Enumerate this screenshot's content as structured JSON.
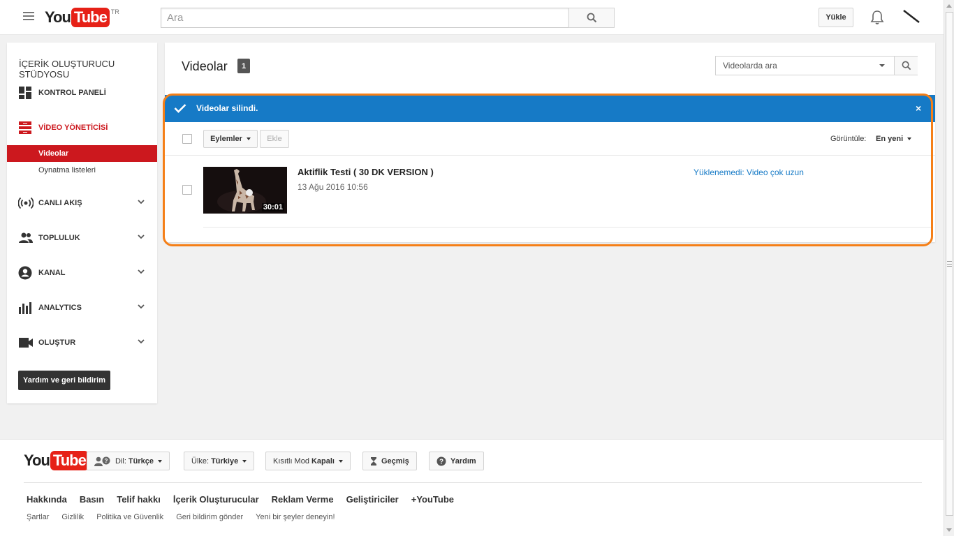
{
  "header": {
    "logo_you": "You",
    "logo_tube": "Tube",
    "region": "TR",
    "search_placeholder": "Ara",
    "upload_label": "Yükle"
  },
  "sidebar": {
    "title": "İÇERİK OLUŞTURUCU STÜDYOSU",
    "items": [
      {
        "label": "KONTROL PANELİ",
        "icon": "dashboard-icon"
      },
      {
        "label": "VİDEO YÖNETİCİSİ",
        "icon": "video-manager-icon",
        "active": true
      },
      {
        "label": "CANLI AKIŞ",
        "icon": "live-icon"
      },
      {
        "label": "TOPLULUK",
        "icon": "community-icon"
      },
      {
        "label": "KANAL",
        "icon": "channel-icon"
      },
      {
        "label": "ANALYTICS",
        "icon": "analytics-icon"
      },
      {
        "label": "OLUŞTUR",
        "icon": "create-icon"
      }
    ],
    "sub_items": [
      {
        "label": "Videolar",
        "selected": true
      },
      {
        "label": "Oynatma listeleri"
      }
    ],
    "help_label": "Yardım ve geri bildirim"
  },
  "main": {
    "title": "Videolar",
    "count": "1",
    "search_placeholder": "Videolarda ara",
    "notice": "Videolar silindi.",
    "close": "×",
    "actions_label": "Eylemler",
    "add_label": "Ekle",
    "view_label": "Görüntüle:",
    "view_value": "En yeni",
    "videos": [
      {
        "title": "Aktiflik Testi ( 30 DK VERSION )",
        "date": "13 Ağu 2016 10:56",
        "duration": "30:01",
        "status": "Yüklenemedi: Video çok uzun"
      }
    ]
  },
  "footer": {
    "logo_you": "You",
    "logo_tube": "Tube",
    "language_prefix": "Dil:",
    "language": "Türkçe",
    "country_prefix": "Ülke:",
    "country": "Türkiye",
    "restricted_prefix": "Kısıtlı Mod",
    "restricted": "Kapalı",
    "history": "Geçmiş",
    "help": "Yardım",
    "links": [
      "Hakkında",
      "Basın",
      "Telif hakkı",
      "İçerik Oluşturucular",
      "Reklam Verme",
      "Geliştiriciler",
      "+YouTube"
    ],
    "small_links": [
      "Şartlar",
      "Gizlilik",
      "Politika ve Güvenlik",
      "Geri bildirim gönder",
      "Yeni bir şeyler deneyin!"
    ]
  },
  "colors": {
    "brand_red": "#e62117",
    "accent_blue": "#167ac6",
    "highlight_orange": "#f57f17",
    "sidebar_selected": "#cc181e"
  }
}
